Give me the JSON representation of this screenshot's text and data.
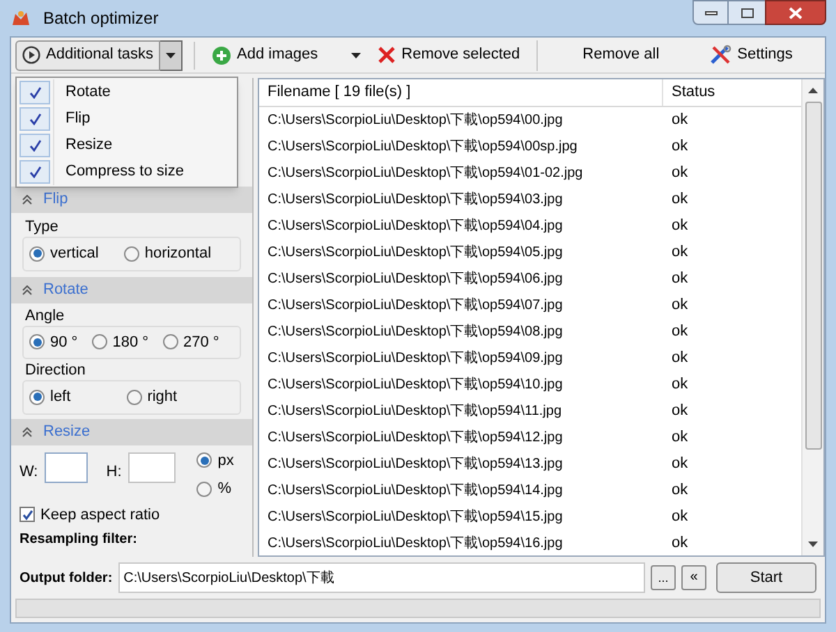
{
  "window": {
    "title": "Batch optimizer"
  },
  "toolbar": {
    "additional_tasks": "Additional tasks",
    "add_images": "Add images",
    "remove_selected": "Remove selected",
    "remove_all": "Remove all",
    "settings": "Settings"
  },
  "tasks_menu": [
    {
      "label": "Rotate",
      "checked": true
    },
    {
      "label": "Flip",
      "checked": true
    },
    {
      "label": "Resize",
      "checked": true
    },
    {
      "label": "Compress to size",
      "checked": true
    }
  ],
  "flip": {
    "header": "Flip",
    "type_label": "Type",
    "options": [
      {
        "label": "vertical",
        "selected": true
      },
      {
        "label": "horizontal",
        "selected": false
      }
    ]
  },
  "rotate": {
    "header": "Rotate",
    "angle_label": "Angle",
    "angles": [
      {
        "label": "90 °",
        "selected": true
      },
      {
        "label": "180 °",
        "selected": false
      },
      {
        "label": "270 °",
        "selected": false
      }
    ],
    "direction_label": "Direction",
    "directions": [
      {
        "label": "left",
        "selected": true
      },
      {
        "label": "right",
        "selected": false
      }
    ]
  },
  "resize": {
    "header": "Resize",
    "w_label": "W:",
    "h_label": "H:",
    "units": [
      {
        "label": "px",
        "selected": true
      },
      {
        "label": "%",
        "selected": false
      }
    ],
    "keep_aspect": {
      "label": "Keep aspect ratio",
      "checked": true
    },
    "resampling_label": "Resampling filter:"
  },
  "table": {
    "columns": [
      "Filename [ 19 file(s) ]",
      "Status"
    ],
    "rows": [
      [
        "C:\\Users\\ScorpioLiu\\Desktop\\下載\\op594\\00.jpg",
        "ok"
      ],
      [
        "C:\\Users\\ScorpioLiu\\Desktop\\下載\\op594\\00sp.jpg",
        "ok"
      ],
      [
        "C:\\Users\\ScorpioLiu\\Desktop\\下載\\op594\\01-02.jpg",
        "ok"
      ],
      [
        "C:\\Users\\ScorpioLiu\\Desktop\\下載\\op594\\03.jpg",
        "ok"
      ],
      [
        "C:\\Users\\ScorpioLiu\\Desktop\\下載\\op594\\04.jpg",
        "ok"
      ],
      [
        "C:\\Users\\ScorpioLiu\\Desktop\\下載\\op594\\05.jpg",
        "ok"
      ],
      [
        "C:\\Users\\ScorpioLiu\\Desktop\\下載\\op594\\06.jpg",
        "ok"
      ],
      [
        "C:\\Users\\ScorpioLiu\\Desktop\\下載\\op594\\07.jpg",
        "ok"
      ],
      [
        "C:\\Users\\ScorpioLiu\\Desktop\\下載\\op594\\08.jpg",
        "ok"
      ],
      [
        "C:\\Users\\ScorpioLiu\\Desktop\\下載\\op594\\09.jpg",
        "ok"
      ],
      [
        "C:\\Users\\ScorpioLiu\\Desktop\\下載\\op594\\10.jpg",
        "ok"
      ],
      [
        "C:\\Users\\ScorpioLiu\\Desktop\\下載\\op594\\11.jpg",
        "ok"
      ],
      [
        "C:\\Users\\ScorpioLiu\\Desktop\\下載\\op594\\12.jpg",
        "ok"
      ],
      [
        "C:\\Users\\ScorpioLiu\\Desktop\\下載\\op594\\13.jpg",
        "ok"
      ],
      [
        "C:\\Users\\ScorpioLiu\\Desktop\\下載\\op594\\14.jpg",
        "ok"
      ],
      [
        "C:\\Users\\ScorpioLiu\\Desktop\\下載\\op594\\15.jpg",
        "ok"
      ],
      [
        "C:\\Users\\ScorpioLiu\\Desktop\\下載\\op594\\16.jpg",
        "ok"
      ]
    ]
  },
  "output": {
    "label": "Output folder:",
    "value": "C:\\Users\\ScorpioLiu\\Desktop\\下載",
    "browse": "...",
    "collapse": "«",
    "start": "Start"
  }
}
